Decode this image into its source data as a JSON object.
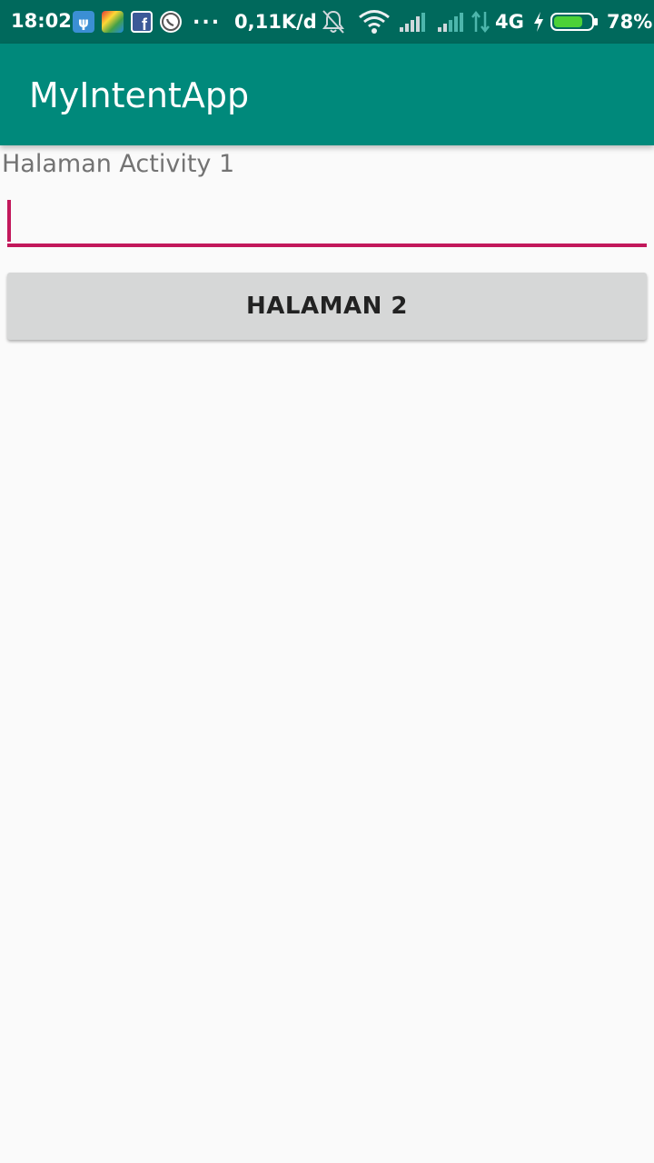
{
  "status_bar": {
    "time": "18:02",
    "more_indicator": "...",
    "network_speed": "0,11K/d",
    "network_type": "4G",
    "battery_percent": "78%",
    "battery_level": 0.78,
    "icons": [
      "ps-icon",
      "gallery-icon",
      "facebook-icon",
      "whatsapp-icon",
      "mute-bell-icon",
      "wifi-icon",
      "signal-icon",
      "signal-icon",
      "data-arrows-icon",
      "charging-icon",
      "battery-icon"
    ]
  },
  "app_bar": {
    "title": "MyIntentApp",
    "color": "#00897b"
  },
  "main": {
    "label": "Halaman Activity 1",
    "input": {
      "value": "",
      "placeholder": "",
      "accent_color": "#c2185b"
    },
    "button_label": "HALAMAN 2"
  }
}
